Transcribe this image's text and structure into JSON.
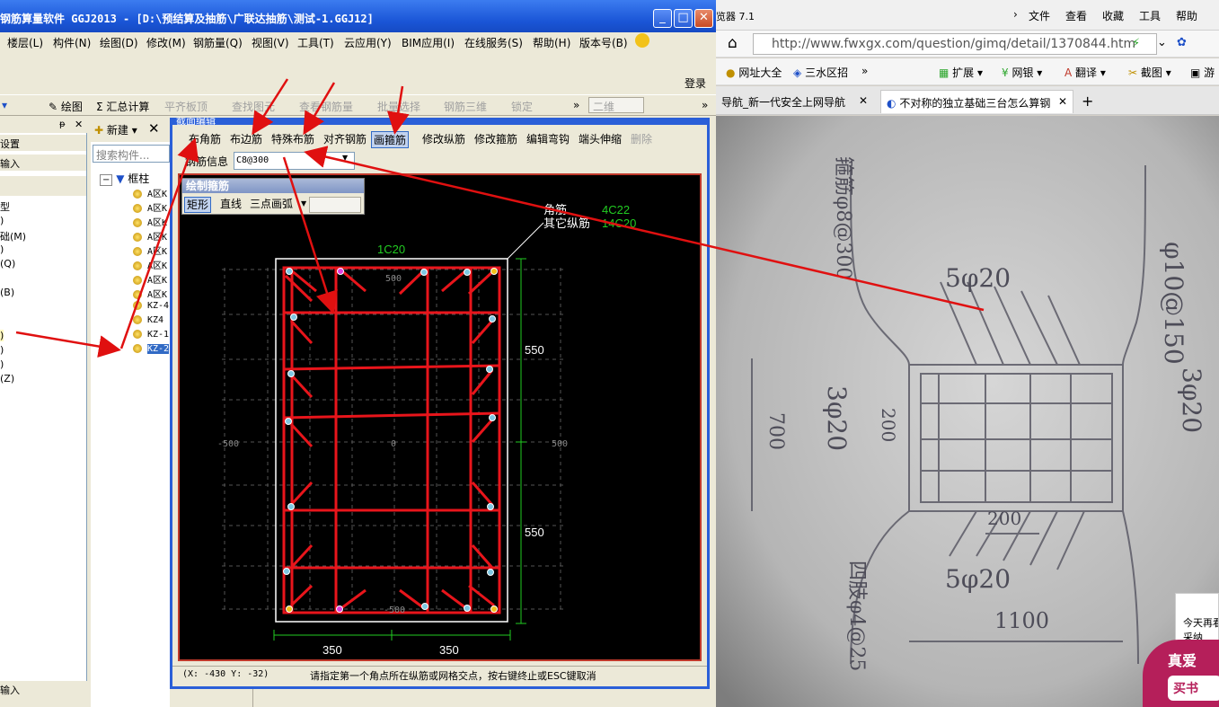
{
  "app": {
    "title": "钢筋算量软件 GGJ2013 - [D:\\预结算及抽筋\\广联达抽筋\\测试-1.GGJ12]",
    "login": "登录",
    "menu": [
      "楼层(L)",
      "构件(N)",
      "绘图(D)",
      "修改(M)",
      "钢筋量(Q)",
      "视图(V)",
      "工具(T)",
      "云应用(Y)",
      "BIM应用(I)",
      "在线服务(S)",
      "帮助(H)",
      "版本号(B)"
    ],
    "toolbar": {
      "draw": "绘图",
      "sum": "汇总计算",
      "flat_top": "平齐板顶",
      "find": "查找图元",
      "view_rebar": "查看钢筋量",
      "batch_select": "批量选择",
      "rebar_3d": "钢筋三维",
      "lock": "锁定",
      "view_mode": "二维"
    },
    "left_panel": {
      "items": [
        "设置",
        "输入",
        "型",
        ")",
        "础(M)",
        ")",
        "(Q)",
        "(B)",
        ")",
        ")",
        ")",
        "(Z)"
      ],
      "bottom": "输入"
    },
    "mid_panel": {
      "new_button": "新建",
      "search_placeholder": "搜索构件...",
      "tree_root": "框柱",
      "tree_items": [
        "A区K",
        "A区K",
        "A区K",
        "A区K",
        "A区K",
        "A区K",
        "A区K",
        "A区K",
        "KZ-4",
        "KZ4",
        "KZ-1",
        "KZ-2"
      ]
    }
  },
  "dialog": {
    "title": "截面编辑",
    "toolbar": [
      "布角筋",
      "布边筋",
      "特殊布筋",
      "对齐钢筋",
      "画箍筋",
      "修改纵筋",
      "修改箍筋",
      "编辑弯钩",
      "端头伸缩",
      "删除"
    ],
    "rebar_info_label": "钢筋信息",
    "rebar_info_value": "C8@300",
    "draw_panel": {
      "title": "绘制箍筋",
      "rect": "矩形",
      "line": "直线",
      "arc": "三点画弧"
    },
    "canvas": {
      "corner_label": "角筋",
      "corner_value": "4C22",
      "other_label": "其它纵筋",
      "other_value": "14C20",
      "top_label": "1C20",
      "dim_right_1": "550",
      "dim_right_2": "550",
      "dim_bottom_1": "350",
      "dim_bottom_2": "350",
      "grid_top": "500",
      "grid_bottom": "-500",
      "grid_left": "-500",
      "grid_right": "500",
      "grid_center": "0"
    },
    "status": {
      "coords": "(X: -430 Y: -32)",
      "message": "请指定第一个角点所在纵筋或网格交点，按右键终止或ESC键取消"
    }
  },
  "browser": {
    "title": "览器 7.1",
    "menu": [
      "文件",
      "查看",
      "收藏",
      "工具",
      "帮助"
    ],
    "url": "http://www.fwxgx.com/question/gimq/detail/1370844.htm",
    "favorites": [
      "网址大全",
      "三水区招",
      "扩展",
      "网银",
      "翻译",
      "截图",
      "游"
    ],
    "tabs": [
      "导航_新一代安全上网导航",
      "不对称的独立基础三台怎么算钢"
    ],
    "popup_text": "今天再看",
    "popup_text2": "采纳",
    "ad_text": "真爱",
    "ad_sub": "买书"
  },
  "photo": {
    "labels": [
      "φ10@150",
      "5φ20",
      "3φ20",
      "3φ20",
      "700",
      "200",
      "200",
      "5φ20",
      "1100",
      "箍筋φ8@300",
      "四肢φ4@25"
    ]
  },
  "colors": {
    "titlebar": "#1a55d6",
    "annotation_arrow": "#e01010",
    "rebar_red": "#e8151b",
    "canvas_bg": "#000000",
    "dim_green": "#22cc22"
  }
}
